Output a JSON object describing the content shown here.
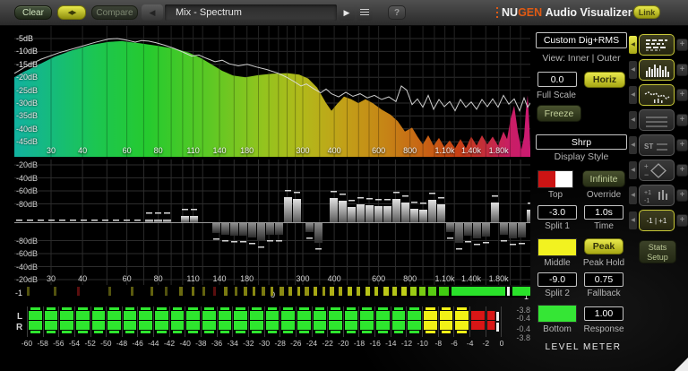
{
  "topbar": {
    "clear": "Clear",
    "swap_icon": "◀▶",
    "compare": "Compare",
    "prev_icon": "◀",
    "preset": "Mix - Spectrum",
    "play_icon": "▶",
    "help": "?",
    "logo_nu": "NU",
    "logo_gen": "GEN",
    "logo_rest": "Audio Visualizer",
    "link": "Link"
  },
  "spectrum_display": {
    "db_labels": [
      "-5dB",
      "-10dB",
      "-15dB",
      "-20dB",
      "-25dB",
      "-30dB",
      "-35dB",
      "-40dB",
      "-45dB"
    ],
    "freq_ticks": [
      {
        "f": 30,
        "l": "30"
      },
      {
        "f": 40,
        "l": "40"
      },
      {
        "f": 50,
        "l": ""
      },
      {
        "f": 60,
        "l": "60"
      },
      {
        "f": 70,
        "l": ""
      },
      {
        "f": 80,
        "l": "80"
      },
      {
        "f": 90,
        "l": ""
      },
      {
        "f": 100,
        "l": ""
      },
      {
        "f": 110,
        "l": "110"
      },
      {
        "f": 120,
        "l": ""
      },
      {
        "f": 140,
        "l": "140"
      },
      {
        "f": 160,
        "l": ""
      },
      {
        "f": 180,
        "l": "180"
      },
      {
        "f": 200,
        "l": ""
      },
      {
        "f": 220,
        "l": ""
      },
      {
        "f": 240,
        "l": ""
      },
      {
        "f": 260,
        "l": ""
      },
      {
        "f": 280,
        "l": ""
      },
      {
        "f": 300,
        "l": "300"
      },
      {
        "f": 350,
        "l": ""
      },
      {
        "f": 400,
        "l": "400"
      },
      {
        "f": 450,
        "l": ""
      },
      {
        "f": 500,
        "l": ""
      },
      {
        "f": 550,
        "l": ""
      },
      {
        "f": 600,
        "l": "600"
      },
      {
        "f": 700,
        "l": ""
      },
      {
        "f": 800,
        "l": "800"
      },
      {
        "f": 900,
        "l": ""
      },
      {
        "f": 1000,
        "l": ""
      },
      {
        "f": 1100,
        "l": "1.10k"
      },
      {
        "f": 1200,
        "l": ""
      },
      {
        "f": 1400,
        "l": "1.40k"
      },
      {
        "f": 1600,
        "l": ""
      },
      {
        "f": 1800,
        "l": "1.80k"
      },
      {
        "f": 2000,
        "l": ""
      },
      {
        "f": 2200,
        "l": ""
      }
    ],
    "gradient": [
      [
        0,
        "#12b2a0"
      ],
      [
        8,
        "#16bc78"
      ],
      [
        16,
        "#1cc650"
      ],
      [
        26,
        "#26ca2e"
      ],
      [
        38,
        "#5ec824"
      ],
      [
        48,
        "#92c41e"
      ],
      [
        56,
        "#b2b81a"
      ],
      [
        64,
        "#c2a018"
      ],
      [
        72,
        "#c68416"
      ],
      [
        80,
        "#c86014"
      ],
      [
        86,
        "#c84014"
      ],
      [
        91,
        "#c42e3a"
      ],
      [
        96,
        "#c81e64"
      ],
      [
        100,
        "#cc1a72"
      ]
    ],
    "fill": [
      [
        0,
        -20
      ],
      [
        10,
        -18
      ],
      [
        25,
        -15.5
      ],
      [
        45,
        -12
      ],
      [
        65,
        -9.5
      ],
      [
        85,
        -7.5
      ],
      [
        105,
        -6.3
      ],
      [
        120,
        -6
      ],
      [
        140,
        -6.8
      ],
      [
        160,
        -7.8
      ],
      [
        180,
        -9
      ],
      [
        195,
        -10.5
      ],
      [
        208,
        -12.5
      ],
      [
        220,
        -15
      ],
      [
        232,
        -17.5
      ],
      [
        244,
        -19.3
      ],
      [
        258,
        -20
      ],
      [
        272,
        -19.2
      ],
      [
        288,
        -18.6
      ],
      [
        305,
        -18.4
      ],
      [
        318,
        -19
      ],
      [
        328,
        -20.5
      ],
      [
        338,
        -24
      ],
      [
        348,
        -30
      ],
      [
        354,
        -33
      ],
      [
        360,
        -30.5
      ],
      [
        368,
        -27.5
      ],
      [
        376,
        -28.5
      ],
      [
        384,
        -30
      ],
      [
        392,
        -28.5
      ],
      [
        400,
        -30
      ],
      [
        410,
        -32.5
      ],
      [
        420,
        -34.5
      ],
      [
        428,
        -37
      ],
      [
        436,
        -41
      ],
      [
        444,
        -39.5
      ],
      [
        450,
        -43
      ],
      [
        456,
        -46
      ],
      [
        462,
        -42.5
      ],
      [
        468,
        -46.5
      ],
      [
        474,
        -43.5
      ],
      [
        480,
        -47
      ],
      [
        486,
        -44.5
      ],
      [
        492,
        -47.5
      ],
      [
        498,
        -44
      ],
      [
        504,
        -47.5
      ],
      [
        510,
        -43
      ],
      [
        516,
        -46.5
      ],
      [
        522,
        -42.5
      ],
      [
        528,
        -46
      ],
      [
        534,
        -43
      ],
      [
        540,
        -46.5
      ],
      [
        546,
        -41
      ],
      [
        550,
        -44
      ],
      [
        554,
        -36
      ],
      [
        558,
        -31
      ],
      [
        562,
        -41
      ],
      [
        566,
        -48
      ],
      [
        569,
        -43
      ],
      [
        571,
        -33
      ],
      [
        573,
        -27
      ],
      [
        575,
        -39
      ],
      [
        576,
        -48
      ]
    ],
    "peak": [
      [
        0,
        -18.5
      ],
      [
        12,
        -16
      ],
      [
        30,
        -13
      ],
      [
        50,
        -10.5
      ],
      [
        70,
        -8.5
      ],
      [
        90,
        -6.5
      ],
      [
        105,
        -5.2
      ],
      [
        115,
        -5
      ],
      [
        125,
        -5.6
      ],
      [
        135,
        -6.4
      ],
      [
        142,
        -5.8
      ],
      [
        150,
        -6
      ],
      [
        158,
        -6.6
      ],
      [
        168,
        -7.6
      ],
      [
        178,
        -8.8
      ],
      [
        188,
        -10.2
      ],
      [
        198,
        -11.8
      ],
      [
        206,
        -11.4
      ],
      [
        214,
        -12.6
      ],
      [
        224,
        -14
      ],
      [
        232,
        -13.4
      ],
      [
        240,
        -14.8
      ],
      [
        250,
        -15.6
      ],
      [
        260,
        -15
      ],
      [
        270,
        -16
      ],
      [
        282,
        -17
      ],
      [
        294,
        -18.4
      ],
      [
        304,
        -20
      ],
      [
        312,
        -21.6
      ],
      [
        320,
        -23.4
      ],
      [
        326,
        -22.6
      ],
      [
        334,
        -24.4
      ],
      [
        342,
        -26
      ],
      [
        348,
        -24.6
      ],
      [
        354,
        -26.4
      ],
      [
        362,
        -27.6
      ],
      [
        370,
        -25.8
      ],
      [
        378,
        -27.4
      ],
      [
        386,
        -26.4
      ],
      [
        394,
        -28
      ],
      [
        402,
        -27
      ],
      [
        410,
        -28.6
      ],
      [
        418,
        -27.6
      ],
      [
        426,
        -29.4
      ],
      [
        432,
        -23.4
      ],
      [
        438,
        -25
      ],
      [
        444,
        -30.6
      ],
      [
        450,
        -28.4
      ],
      [
        456,
        -31.6
      ],
      [
        462,
        -27
      ],
      [
        468,
        -32.4
      ],
      [
        474,
        -28.6
      ],
      [
        480,
        -31.4
      ],
      [
        486,
        -29.4
      ],
      [
        492,
        -33
      ],
      [
        498,
        -28.6
      ],
      [
        504,
        -31.6
      ],
      [
        510,
        -29.6
      ],
      [
        516,
        -32.4
      ],
      [
        522,
        -28.6
      ],
      [
        528,
        -31.4
      ],
      [
        534,
        -28.4
      ],
      [
        540,
        -31.6
      ],
      [
        546,
        -27
      ],
      [
        552,
        -30.4
      ],
      [
        558,
        -28.4
      ],
      [
        564,
        -33
      ],
      [
        569,
        -28
      ],
      [
        573,
        -31.6
      ],
      [
        576,
        -30
      ]
    ]
  },
  "split_display": {
    "db_labels_top": [
      "-20dB",
      "-40dB",
      "-60dB",
      "-80dB"
    ],
    "db_labels_bottom": [
      "-80dB",
      "-60dB",
      "-40dB",
      "-20dB"
    ],
    "bars": [
      [
        146,
        3,
        0
      ],
      [
        156,
        3,
        0
      ],
      [
        166,
        3,
        0
      ],
      [
        186,
        7,
        0
      ],
      [
        196,
        7,
        0
      ],
      [
        221,
        0,
        11
      ],
      [
        231,
        0,
        13
      ],
      [
        241,
        0,
        14
      ],
      [
        251,
        0,
        14
      ],
      [
        261,
        0,
        16
      ],
      [
        271,
        0,
        20
      ],
      [
        281,
        0,
        13
      ],
      [
        291,
        0,
        13
      ],
      [
        301,
        28,
        0
      ],
      [
        311,
        26,
        0
      ],
      [
        325,
        0,
        10
      ],
      [
        335,
        0,
        22
      ],
      [
        352,
        27,
        0
      ],
      [
        362,
        24,
        0
      ],
      [
        372,
        17,
        0
      ],
      [
        382,
        20,
        0
      ],
      [
        392,
        19,
        0
      ],
      [
        402,
        18,
        0
      ],
      [
        412,
        18,
        0
      ],
      [
        422,
        26,
        0
      ],
      [
        432,
        22,
        0
      ],
      [
        442,
        15,
        0
      ],
      [
        452,
        14,
        0
      ],
      [
        462,
        25,
        0
      ],
      [
        472,
        20,
        0
      ],
      [
        482,
        0,
        10
      ],
      [
        492,
        0,
        22
      ],
      [
        502,
        0,
        14
      ],
      [
        512,
        0,
        17
      ],
      [
        522,
        0,
        15
      ],
      [
        532,
        22,
        0
      ],
      [
        542,
        0,
        13
      ],
      [
        552,
        0,
        17
      ],
      [
        562,
        0,
        16
      ],
      [
        572,
        14,
        0
      ]
    ]
  },
  "correlation": {
    "min_label": "-1",
    "mid_label": "0",
    "max_label": "1",
    "segments": [
      [
        14,
        3,
        "#52520e"
      ],
      [
        44,
        3,
        "#52520e"
      ],
      [
        70,
        3,
        "#5a0e0e"
      ],
      [
        105,
        3,
        "#52520e"
      ],
      [
        130,
        3,
        "#5a5a0e"
      ],
      [
        152,
        3,
        "#62620e"
      ],
      [
        168,
        3,
        "#52520e"
      ],
      [
        184,
        4,
        "#6a6a10"
      ],
      [
        198,
        3,
        "#727210"
      ],
      [
        210,
        3,
        "#62620e"
      ],
      [
        222,
        3,
        "#5a0e0e"
      ],
      [
        234,
        4,
        "#7a7a10"
      ],
      [
        246,
        3,
        "#6a6a10"
      ],
      [
        256,
        4,
        "#828210"
      ],
      [
        266,
        3,
        "#8a8a12"
      ],
      [
        276,
        4,
        "#7a7a10"
      ],
      [
        286,
        3,
        "#929212"
      ],
      [
        296,
        5,
        "#8a8a12"
      ],
      [
        306,
        4,
        "#9a9a14"
      ],
      [
        316,
        3,
        "#a2a214"
      ],
      [
        324,
        5,
        "#929212"
      ],
      [
        334,
        4,
        "#a8a814"
      ],
      [
        344,
        3,
        "#9a9a14"
      ],
      [
        352,
        5,
        "#b0b016"
      ],
      [
        362,
        4,
        "#a8a814"
      ],
      [
        372,
        5,
        "#b4bc16"
      ],
      [
        382,
        4,
        "#aab216"
      ],
      [
        392,
        5,
        "#b8c418"
      ],
      [
        402,
        4,
        "#b0bc16"
      ],
      [
        412,
        6,
        "#bcc818"
      ],
      [
        422,
        5,
        "#b4c418"
      ],
      [
        432,
        6,
        "#c0d018"
      ],
      [
        442,
        7,
        "#9ccc14"
      ],
      [
        452,
        7,
        "#78cc12"
      ],
      [
        462,
        9,
        "#58cc12"
      ],
      [
        474,
        11,
        "#40cc11"
      ],
      [
        488,
        60,
        "#2ae22a"
      ],
      [
        550,
        3,
        "#f0f0f0"
      ],
      [
        556,
        20,
        "#2ae22a"
      ]
    ]
  },
  "meter": {
    "channel_labels": [
      "L",
      "R"
    ],
    "scale_labels": [
      "-60",
      "-58",
      "-56",
      "-54",
      "-52",
      "-50",
      "-48",
      "-46",
      "-44",
      "-42",
      "-40",
      "-38",
      "-36",
      "-34",
      "-32",
      "-30",
      "-28",
      "-26",
      "-24",
      "-22",
      "-20",
      "-18",
      "-16",
      "-14",
      "-12",
      "-10",
      "-8",
      "-6",
      "-4",
      "-2",
      "0"
    ],
    "segments": 30,
    "green_until": 25,
    "yellow_until": 28,
    "colors": {
      "green": "#2ee62e",
      "yellow": "#f2f216",
      "red": "#d81616"
    },
    "readouts": [
      "-3.8",
      "-0.4",
      "-0.4",
      "-3.8"
    ]
  },
  "panel": {
    "mode": "Custom Dig+RMS",
    "view": "View: Inner | Outer",
    "full_scale_value": "0.0",
    "horiz": "Horiz",
    "full_scale_label": "Full Scale",
    "freeze": "Freeze",
    "display_style_value": "Shrp",
    "display_style_label": "Display Style",
    "top_label": "Top",
    "override_value": "Infinite",
    "override_label": "Override",
    "split1_value": "-3.0",
    "split1_label": "Split 1",
    "time_value": "1.0s",
    "time_label": "Time",
    "middle_label": "Middle",
    "peak_value": "Peak",
    "peak_hold_label": "Peak Hold",
    "split2_value": "-9.0",
    "split2_label": "Split 2",
    "fallback_value": "0.75",
    "fallback_label": "Fallback",
    "bottom_label": "Bottom",
    "response_value": "1.00",
    "response_label": "Response",
    "swatches": {
      "top_left": "#cc1414",
      "top_right": "#ffffff",
      "middle": "#f2f220",
      "bottom": "#35e635"
    },
    "level_meter_title": "LEVEL METER"
  },
  "rightstrip": {
    "tab_icon": "◀",
    "add_label": "+",
    "buttons": [
      {
        "name": "meter-view",
        "glyph": "bars-h",
        "active": true
      },
      {
        "name": "spectrum-bars-view",
        "glyph": "bars-v",
        "active": true
      },
      {
        "name": "spectrum-line-view",
        "glyph": "scatter",
        "active": true
      },
      {
        "name": "multi-wave-view",
        "glyph": "waves",
        "active": false
      },
      {
        "name": "stereo-wave-view",
        "glyph": "st-waves",
        "active": false,
        "text": "ST"
      },
      {
        "name": "vectorscope-view",
        "glyph": "diamond",
        "active": false
      },
      {
        "name": "peak-meter-view",
        "glyph": "pm",
        "active": false,
        "text_top": "+1",
        "text_bottom": "-1"
      },
      {
        "name": "balance-view",
        "glyph": "text",
        "active": true,
        "text": "-1 | +1"
      }
    ],
    "stats_line1": "Stats",
    "stats_line2": "Setup"
  }
}
